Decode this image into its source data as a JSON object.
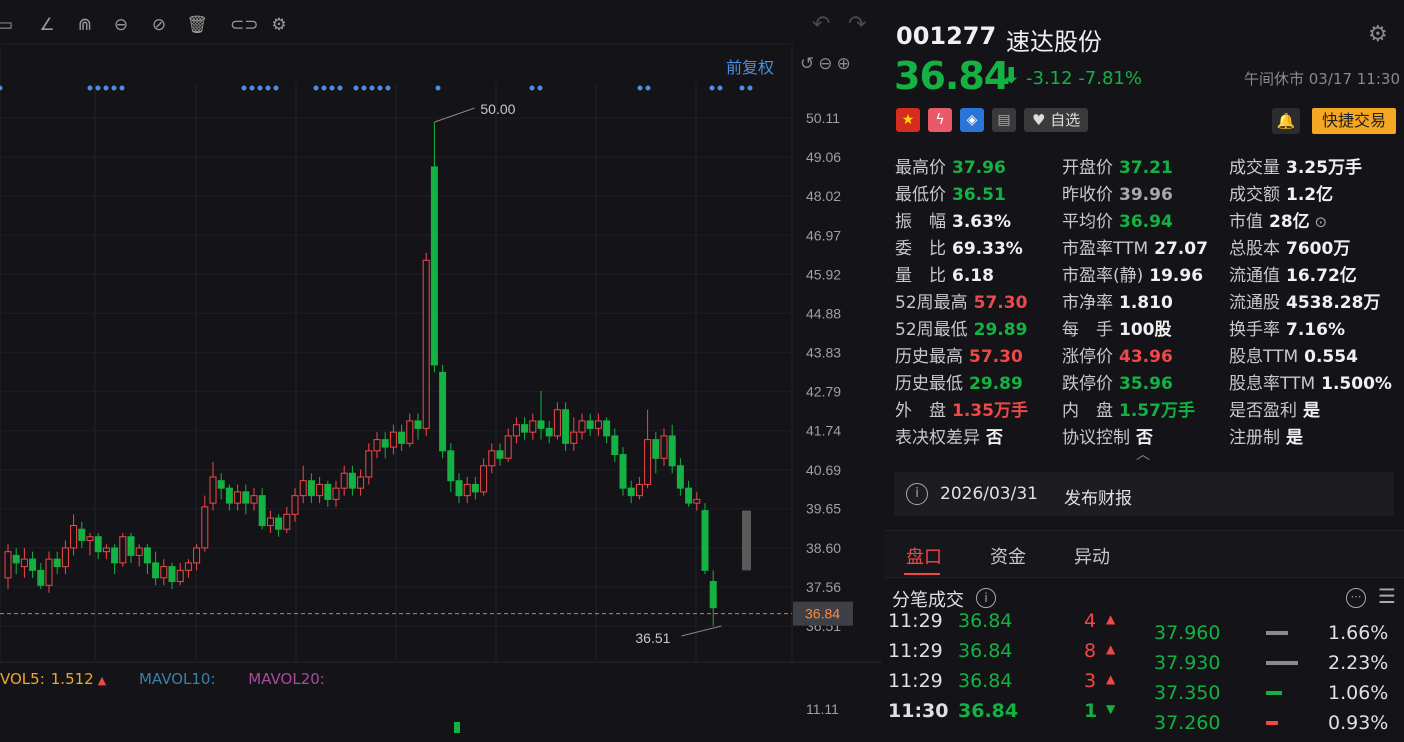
{
  "chart": {
    "price_axis": [
      "50.11",
      "49.06",
      "48.02",
      "46.97",
      "45.92",
      "44.88",
      "43.83",
      "42.79",
      "41.74",
      "40.69",
      "39.65",
      "38.60",
      "37.56",
      "36.51"
    ],
    "current_price_tag": "36.84",
    "high_annotation": "50.00",
    "low_annotation": "36.51",
    "fq_label": "前复权",
    "vol_axis_label": "11.11",
    "vol_legend": {
      "mavol5_label": "VOL5:",
      "mavol5_value": "1.512",
      "mavol10_label": "MAVOL10:",
      "mavol20_label": "MAVOL20:"
    },
    "colors": {
      "up": "#f04848",
      "down": "#14b143",
      "ma5": "#f5a623",
      "ma10": "#3a7fa8",
      "ma20": "#a84b9c",
      "price_line": "#ff6a2a"
    }
  },
  "stock": {
    "code": "001277",
    "name": "速达股份",
    "price": "36.84",
    "change": "-3.12",
    "change_pct": "-7.81%",
    "status": "午间休市 03/17 11:30",
    "fav_label": "自选",
    "quick_trade": "快捷交易"
  },
  "stats": [
    [
      {
        "l": "最高价",
        "v": "37.96",
        "c": "g"
      },
      {
        "l": "开盘价",
        "v": "37.21",
        "c": "g"
      },
      {
        "l": "成交量",
        "v": "3.25万手",
        "c": "w"
      }
    ],
    [
      {
        "l": "最低价",
        "v": "36.51",
        "c": "g"
      },
      {
        "l": "昨收价",
        "v": "39.96",
        "c": "gr"
      },
      {
        "l": "成交额",
        "v": "1.2亿",
        "c": "w"
      }
    ],
    [
      {
        "l": "振　幅",
        "v": "3.63%",
        "c": "w"
      },
      {
        "l": "平均价",
        "v": "36.94",
        "c": "g"
      },
      {
        "l": "市值",
        "v": "28亿",
        "c": "w"
      }
    ],
    [
      {
        "l": "委　比",
        "v": "69.33%",
        "c": "w"
      },
      {
        "l": "市盈率TTM",
        "v": "27.07",
        "c": "w"
      },
      {
        "l": "总股本",
        "v": "7600万",
        "c": "w"
      }
    ],
    [
      {
        "l": "量　比",
        "v": "6.18",
        "c": "w"
      },
      {
        "l": "市盈率(静)",
        "v": "19.96",
        "c": "w"
      },
      {
        "l": "流通值",
        "v": "16.72亿",
        "c": "w"
      }
    ],
    [
      {
        "l": "52周最高",
        "v": "57.30",
        "c": "r"
      },
      {
        "l": "市净率",
        "v": "1.810",
        "c": "w"
      },
      {
        "l": "流通股",
        "v": "4538.28万",
        "c": "w"
      }
    ],
    [
      {
        "l": "52周最低",
        "v": "29.89",
        "c": "g"
      },
      {
        "l": "每　手",
        "v": "100股",
        "c": "w"
      },
      {
        "l": "换手率",
        "v": "7.16%",
        "c": "w"
      }
    ],
    [
      {
        "l": "历史最高",
        "v": "57.30",
        "c": "r"
      },
      {
        "l": "涨停价",
        "v": "43.96",
        "c": "r"
      },
      {
        "l": "股息TTM",
        "v": "0.554",
        "c": "w"
      }
    ],
    [
      {
        "l": "历史最低",
        "v": "29.89",
        "c": "g"
      },
      {
        "l": "跌停价",
        "v": "35.96",
        "c": "g"
      },
      {
        "l": "股息率TTM",
        "v": "1.500%",
        "c": "w"
      }
    ],
    [
      {
        "l": "外　盘",
        "v": "1.35万手",
        "c": "r"
      },
      {
        "l": "内　盘",
        "v": "1.57万手",
        "c": "g"
      },
      {
        "l": "是否盈利",
        "v": "是",
        "c": "w"
      }
    ],
    [
      {
        "l": "表决权差异",
        "v": "否",
        "c": "w"
      },
      {
        "l": "协议控制",
        "v": "否",
        "c": "w"
      },
      {
        "l": "注册制",
        "v": "是",
        "c": "w"
      }
    ]
  ],
  "report": {
    "date": "2026/03/31",
    "text": "发布财报"
  },
  "tabs": [
    "盘口",
    "资金",
    "异动"
  ],
  "trades_title": "分笔成交",
  "trades": [
    {
      "time": "11:29",
      "price": "36.84",
      "vol": "4",
      "dir": "up"
    },
    {
      "time": "11:29",
      "price": "36.84",
      "vol": "8",
      "dir": "up"
    },
    {
      "time": "11:29",
      "price": "36.84",
      "vol": "3",
      "dir": "up"
    },
    {
      "time": "11:30",
      "price": "36.84",
      "vol": "1",
      "dir": "down"
    }
  ],
  "levels": [
    {
      "price": "37.960",
      "pct": "1.66%",
      "bar": "gray"
    },
    {
      "price": "37.930",
      "pct": "2.23%",
      "bar": "gray"
    },
    {
      "price": "37.350",
      "pct": "1.06%",
      "bar": "green"
    },
    {
      "price": "37.260",
      "pct": "0.93%",
      "bar": "red"
    }
  ]
}
